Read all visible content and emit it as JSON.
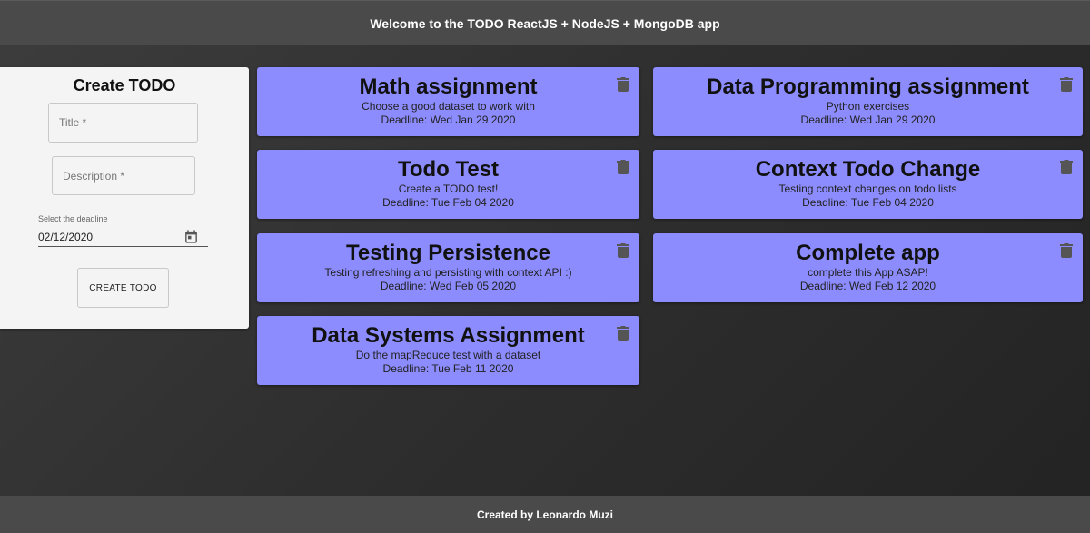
{
  "header": {
    "title": "Welcome to the TODO ReactJS + NodeJS + MongoDB app"
  },
  "create_form": {
    "heading": "Create TODO",
    "title_placeholder": "Title *",
    "description_placeholder": "Description *",
    "deadline_label": "Select the deadline",
    "deadline_value": "02/12/2020",
    "submit_label": "CREATE TODO"
  },
  "todos": [
    {
      "title": "Math assignment",
      "description": "Choose a good dataset to work with",
      "deadline": "Deadline: Wed Jan 29 2020"
    },
    {
      "title": "Data Programming assignment",
      "description": "Python exercises",
      "deadline": "Deadline: Wed Jan 29 2020"
    },
    {
      "title": "Todo Test",
      "description": "Create a TODO test!",
      "deadline": "Deadline: Tue Feb 04 2020"
    },
    {
      "title": "Context Todo Change",
      "description": "Testing context changes on todo lists",
      "deadline": "Deadline: Tue Feb 04 2020"
    },
    {
      "title": "Testing Persistence",
      "description": "Testing refreshing and persisting with context API :)",
      "deadline": "Deadline: Wed Feb 05 2020"
    },
    {
      "title": "Complete app",
      "description": "complete this App ASAP!",
      "deadline": "Deadline: Wed Feb 12 2020"
    },
    {
      "title": "Data Systems Assignment",
      "description": "Do the mapReduce test with a dataset",
      "deadline": "Deadline: Tue Feb 11 2020"
    }
  ],
  "footer": {
    "text": "Created by Leonardo Muzi"
  },
  "colors": {
    "card": "#8c8cff",
    "header": "#4a4a4a",
    "panel": "#f4f4f4"
  },
  "icons": {
    "delete": "trash-icon",
    "date": "calendar-icon"
  }
}
